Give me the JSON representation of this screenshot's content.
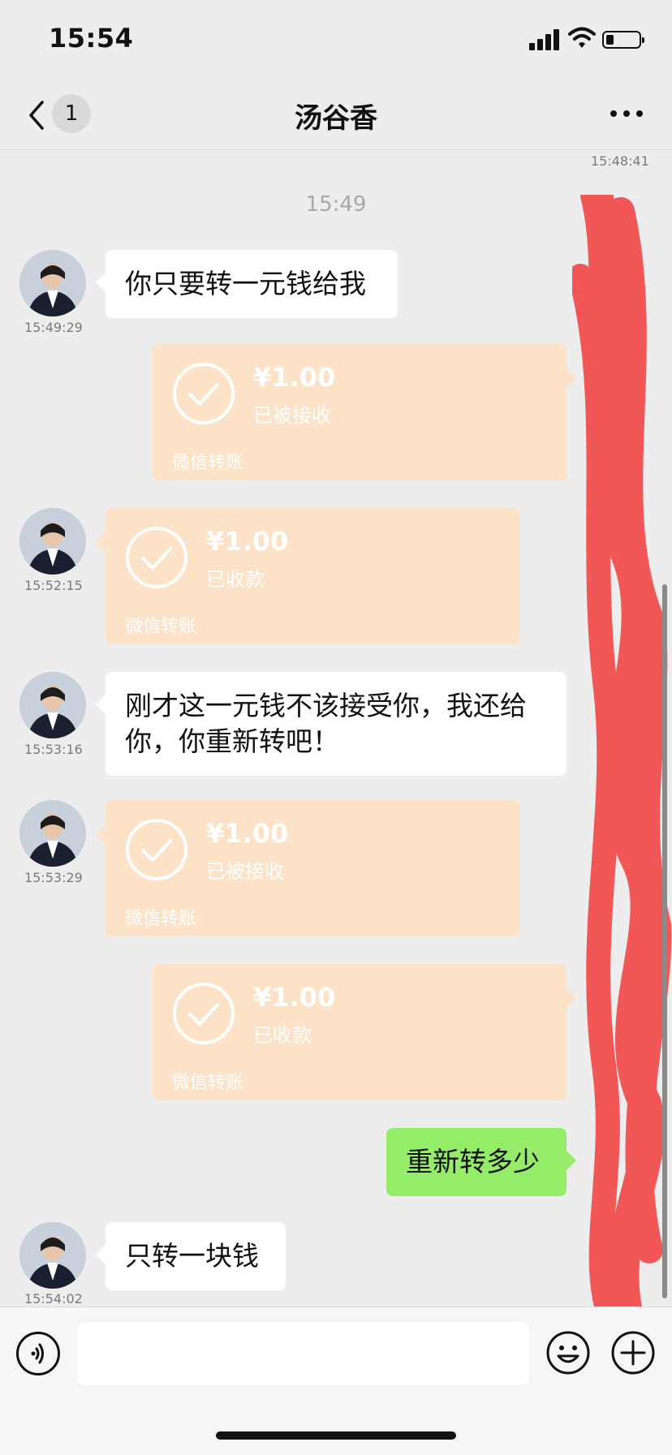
{
  "status_bar": {
    "time": "15:54"
  },
  "nav": {
    "unread_count": "1",
    "title": "汤谷香"
  },
  "chat": {
    "top_partial_time": "15:48:41",
    "divider_time": "15:49",
    "messages": [
      {
        "type": "text",
        "side": "left",
        "text": "你只要转一元钱给我",
        "time": "15:49:29"
      },
      {
        "type": "transfer",
        "side": "right",
        "amount": "¥1.00",
        "status": "已被接收",
        "footer": "微信转账"
      },
      {
        "type": "transfer",
        "side": "left",
        "amount": "¥1.00",
        "status": "已收款",
        "footer": "微信转账",
        "time": "15:52:15"
      },
      {
        "type": "text",
        "side": "left",
        "line1": "刚才这一元钱不该接受你，我还给",
        "line2": "你，你重新转吧！",
        "time": "15:53:16"
      },
      {
        "type": "transfer",
        "side": "left",
        "amount": "¥1.00",
        "status": "已被接收",
        "footer": "微信转账",
        "time": "15:53:29"
      },
      {
        "type": "transfer",
        "side": "right",
        "amount": "¥1.00",
        "status": "已收款",
        "footer": "微信转账"
      },
      {
        "type": "text",
        "side": "right",
        "text": "重新转多少"
      },
      {
        "type": "text",
        "side": "left",
        "text": "只转一块钱",
        "time": "15:54:02"
      }
    ]
  },
  "colors": {
    "outgoing_bubble": "#95ec69",
    "transfer_card": "#fce2c6",
    "redaction": "#f25757"
  },
  "input_bar": {
    "icons": [
      "voice-icon",
      "emoji-icon",
      "plus-icon"
    ]
  }
}
